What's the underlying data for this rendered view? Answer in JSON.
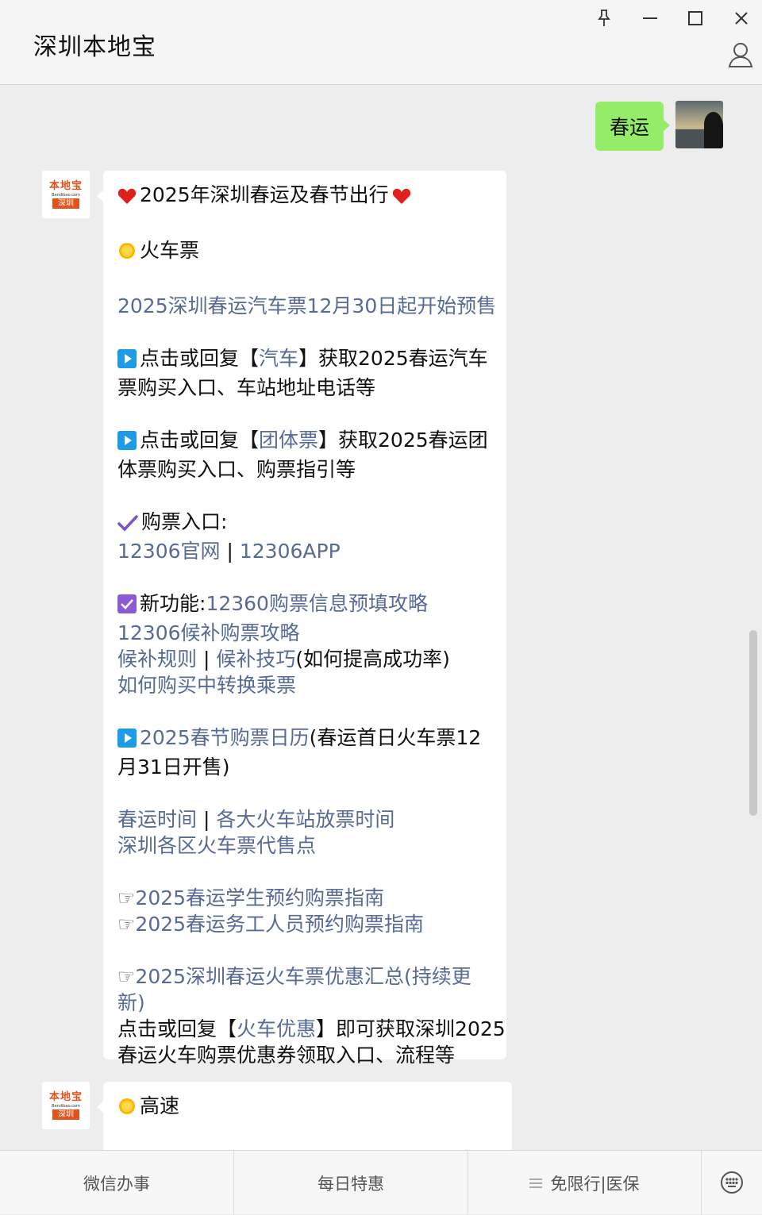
{
  "header": {
    "title": "深圳本地宝",
    "pin_icon": "pin-icon",
    "minimize_icon": "minimize-icon",
    "maximize_icon": "maximize-icon",
    "close_icon": "close-icon",
    "profile_icon": "person-icon"
  },
  "outgoing": {
    "text": "春运"
  },
  "bot": {
    "logo_top": "本地宝",
    "logo_mid": "Bendibao.com",
    "logo_badge": "深圳"
  },
  "message1": {
    "heading": "2025年深圳春运及春节出行",
    "train_section": "火车票",
    "bus_presale_link": "2025深圳春运汽车票12月30日起开始预售",
    "bus_reply": {
      "prefix": "点击或回复【",
      "keyword": "汽车",
      "suffix": "】获取2025春运汽车",
      "line2": "票购买入口、车站地址电话等"
    },
    "group_reply": {
      "prefix": "点击或回复【",
      "keyword": "团体票",
      "suffix": "】获取2025春运团",
      "line2": "体票购买入口、购票指引等"
    },
    "purchase_entry_label": "购票入口:",
    "link_12306_web": "12306官网",
    "separator": " | ",
    "link_12306_app": "12306APP",
    "new_feature_label": "新功能:",
    "link_prefill": "12360购票信息预填攻略",
    "link_waitlist_guide": "12306候补购票攻略",
    "link_waitlist_rules": "候补规则",
    "link_waitlist_tips": "候补技巧",
    "waitlist_tips_note": "(如何提高成功率)",
    "link_transfer": "如何购买中转换乘票",
    "link_calendar": "2025春节购票日历",
    "calendar_note_1": "(春运首日火车票12",
    "calendar_note_2": "月31日开售)",
    "link_spring_time": "春运时间",
    "link_station_release": "各大火车站放票时间",
    "link_agency": "深圳各区火车票代售点",
    "pointer": "☞",
    "link_student": "2025春运学生预约购票指南",
    "link_worker": "2025春运务工人员预约购票指南",
    "link_discount_1": "2025深圳春运火车票优惠汇总(持续更",
    "link_discount_2": "新)",
    "discount_reply": {
      "prefix": "点击或回复【",
      "keyword": "火车优惠",
      "suffix": "】即可获取深圳2025",
      "line2": "春运火车购票优惠券领取入口、流程等"
    }
  },
  "message2": {
    "section": "高速"
  },
  "menu": {
    "item1": "微信办事",
    "item2": "每日特惠",
    "item3": "免限行|医保",
    "item3_icon": "list-icon",
    "keyboard_icon": "keyboard-icon"
  },
  "colors": {
    "link": "#576b95",
    "outgoing_bubble": "#95ec69",
    "brand_orange": "#e2531c"
  }
}
